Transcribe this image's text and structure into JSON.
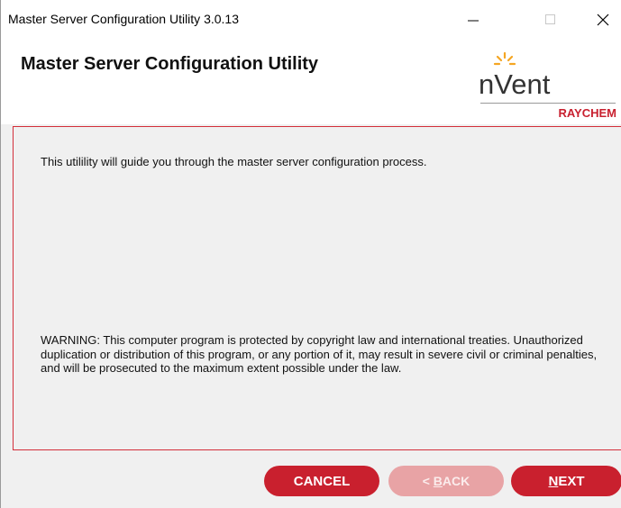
{
  "window": {
    "title": "Master Server Configuration Utility 3.0.13"
  },
  "header": {
    "heading": "Master Server Configuration Utility",
    "logo": {
      "wordmark": "nVent",
      "sub": "RAYCHEM"
    }
  },
  "content": {
    "intro": "This utilility will guide you through the master server configuration process.",
    "warning": "WARNING: This computer program is protected by copyright law and international treaties. Unauthorized duplication or distribution of this program, or any portion of it, may result in severe civil or criminal penalties, and will be prosecuted to the maximum extent possible under the law."
  },
  "buttons": {
    "cancel": "CANCEL",
    "back_prefix": "< ",
    "back_mnemonic": "B",
    "back_rest": "ACK",
    "next_mnemonic": "N",
    "next_rest": "EXT"
  },
  "colors": {
    "accent": "#c9202e",
    "accent_disabled": "#e8a3a5",
    "logo_rays": "#f5a623"
  }
}
